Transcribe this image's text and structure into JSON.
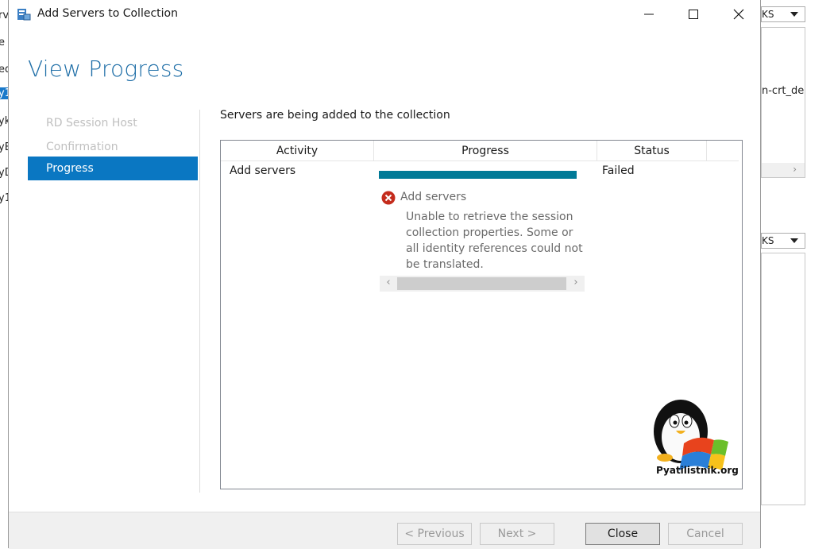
{
  "background": {
    "left_items": [
      "rv",
      "e",
      "ed",
      "y1",
      "yk",
      "yE",
      "yD",
      "y1"
    ],
    "right_dropdown_1": "KS",
    "right_panel_text": "n-crt_de",
    "right_dropdown_2": "KS"
  },
  "dialog": {
    "title": "Add Servers to Collection",
    "page_title": "View Progress",
    "nav": [
      {
        "label": "RD Session Host",
        "state": "disabled"
      },
      {
        "label": "Confirmation",
        "state": "disabled"
      },
      {
        "label": "Progress",
        "state": "active"
      }
    ],
    "heading": "Servers are being added to the collection",
    "table": {
      "columns": [
        "Activity",
        "Progress",
        "Status"
      ],
      "rows": [
        {
          "activity": "Add servers",
          "progress_fraction": 1.0,
          "status": "Failed"
        }
      ]
    },
    "error": {
      "title": "Add servers",
      "message": "Unable to retrieve the session\ncollection properties. Some or\nall identity references could not\nbe translated."
    },
    "buttons": {
      "previous": "< Previous",
      "next": "Next >",
      "close": "Close",
      "cancel": "Cancel"
    }
  },
  "watermark": "Pyatilistnik.org",
  "colors": {
    "accent": "#0a77c2",
    "title_blue": "#1e6ea7",
    "progress_fill": "#007a97",
    "error_red": "#c42b1c"
  }
}
